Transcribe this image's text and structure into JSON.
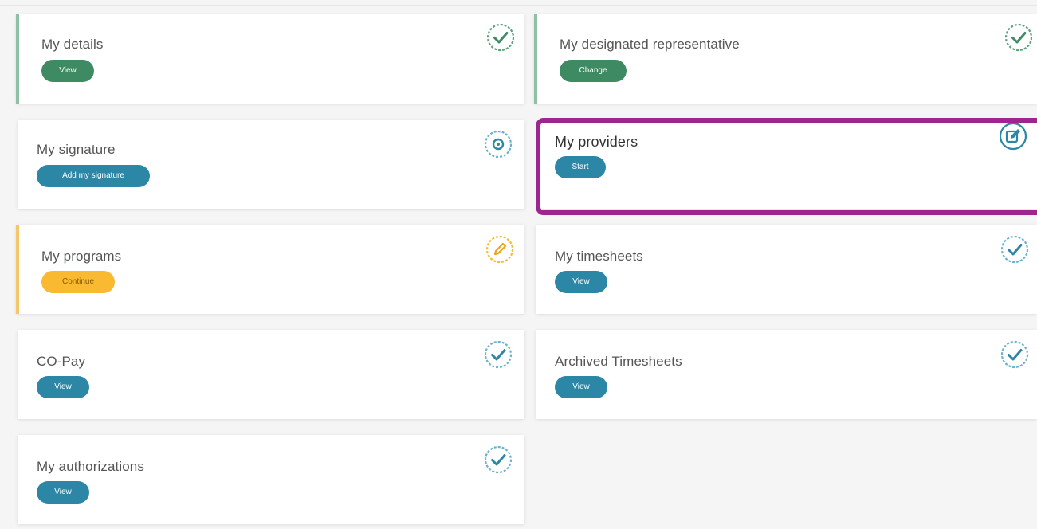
{
  "cards": {
    "my_details": {
      "title": "My details",
      "button": "View",
      "note": ""
    },
    "designated_rep": {
      "title": "My designated representative",
      "button": "Change",
      "note": ""
    },
    "my_signature": {
      "title": "My signature",
      "button": "Add my signature"
    },
    "my_providers": {
      "title": "My providers",
      "button": "Start"
    },
    "my_programs": {
      "title": "My programs",
      "button": "Continue"
    },
    "my_timesheets": {
      "title": "My timesheets",
      "button": "View"
    },
    "co_pay": {
      "title": "CO-Pay",
      "button": "View"
    },
    "archived_timesheets": {
      "title": "Archived Timesheets",
      "button": "View"
    },
    "my_authorizations": {
      "title": "My authorizations",
      "button": "View"
    }
  },
  "icons": {
    "complete_green": "check-circle-icon",
    "complete_blue": "check-circle-icon",
    "in_progress_orange": "pencil-circle-icon",
    "not_started": "dot-circle-icon",
    "edit": "edit-icon"
  },
  "colors": {
    "green": "#3e8b63",
    "blue": "#2c87a7",
    "orange": "#f9b931",
    "highlight": "#a0248f"
  }
}
